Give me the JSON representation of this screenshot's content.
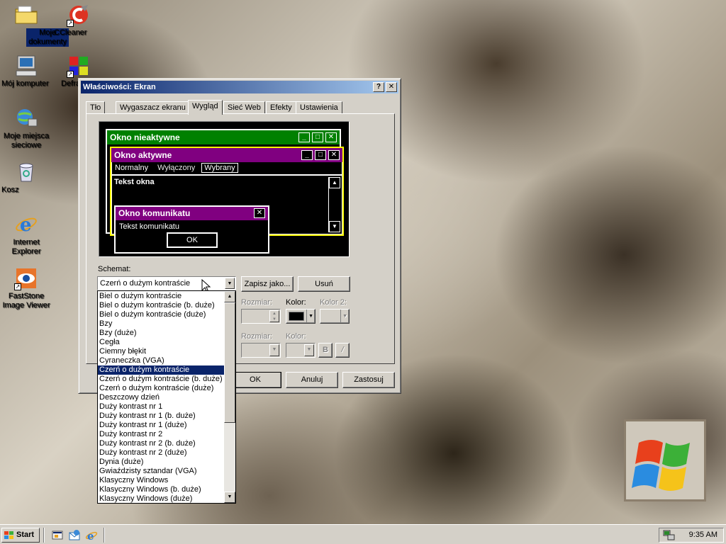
{
  "desktop": {
    "icons": [
      {
        "label": "Moje dokumenty"
      },
      {
        "label": "CCleaner"
      },
      {
        "label": "Mój komputer"
      },
      {
        "label": "Defra"
      },
      {
        "label": "Moje miejsca sieciowe"
      },
      {
        "label": "Kosz"
      },
      {
        "label": "Internet Explorer"
      },
      {
        "label": "FastStone Image Viewer"
      }
    ]
  },
  "dialog": {
    "title": "Właściwości: Ekran",
    "help_btn": "?",
    "close_btn": "✕",
    "tabs": [
      {
        "label": "Tło"
      },
      {
        "label": "Wygaszacz ekranu"
      },
      {
        "label": "Wygląd",
        "active": true
      },
      {
        "label": "Sieć Web"
      },
      {
        "label": "Efekty"
      },
      {
        "label": "Ustawienia"
      }
    ],
    "preview": {
      "inactive_title": "Okno nieaktywne",
      "active_title": "Okno aktywne",
      "menu_normal": "Normalny",
      "menu_disabled": "Wyłączony",
      "menu_selected": "Wybrany",
      "window_text": "Tekst okna",
      "msgbox_title": "Okno komunikatu",
      "msgbox_text": "Tekst komunikatu",
      "msgbox_ok": "OK",
      "colors": {
        "inactive": "#008000",
        "active": "#800080",
        "text": "#ffffff",
        "bg": "#000000"
      }
    },
    "scheme": {
      "label": "Schemat:",
      "value": "Czerń o dużym kontraście",
      "save_as": "Zapisz jako...",
      "delete": "Usuń"
    },
    "item_size_label": "Rozmiar:",
    "color_label": "Kolor:",
    "color2_label": "Kolor 2:",
    "font_size_label": "Rozmiar:",
    "font_color_label": "Kolor:",
    "bold_btn": "B",
    "italic_btn": "/",
    "buttons": {
      "ok": "OK",
      "cancel": "Anuluj",
      "apply": "Zastosuj"
    },
    "dropdown_items": [
      "Biel o dużym kontraście",
      "Biel o dużym kontraście (b. duże)",
      "Biel o dużym kontraście (duże)",
      "Bzy",
      "Bzy (duże)",
      "Cegła",
      "Ciemny błękit",
      "Cyraneczka (VGA)",
      "Czerń o dużym kontraście",
      "Czerń o dużym kontraście (b. duże)",
      "Czerń o dużym kontraście (duże)",
      "Deszczowy dzień",
      "Duży kontrast nr 1",
      "Duży kontrast nr 1 (b. duże)",
      "Duży kontrast nr 1 (duże)",
      "Duży kontrast nr 2",
      "Duży kontrast nr 2 (b. duże)",
      "Duży kontrast nr 2 (duże)",
      "Dynia (duże)",
      "Gwiaździsty sztandar (VGA)",
      "Klasyczny Windows",
      "Klasyczny Windows (b. duże)",
      "Klasyczny Windows (duże)"
    ],
    "selected_index": 8
  },
  "taskbar": {
    "start_label": "Start",
    "clock": "9:35 AM"
  },
  "colors": {
    "titlebar_start": "#0a246a",
    "titlebar_end": "#a6caf0",
    "face": "#d4d0c8",
    "selection": "#0a246a"
  }
}
